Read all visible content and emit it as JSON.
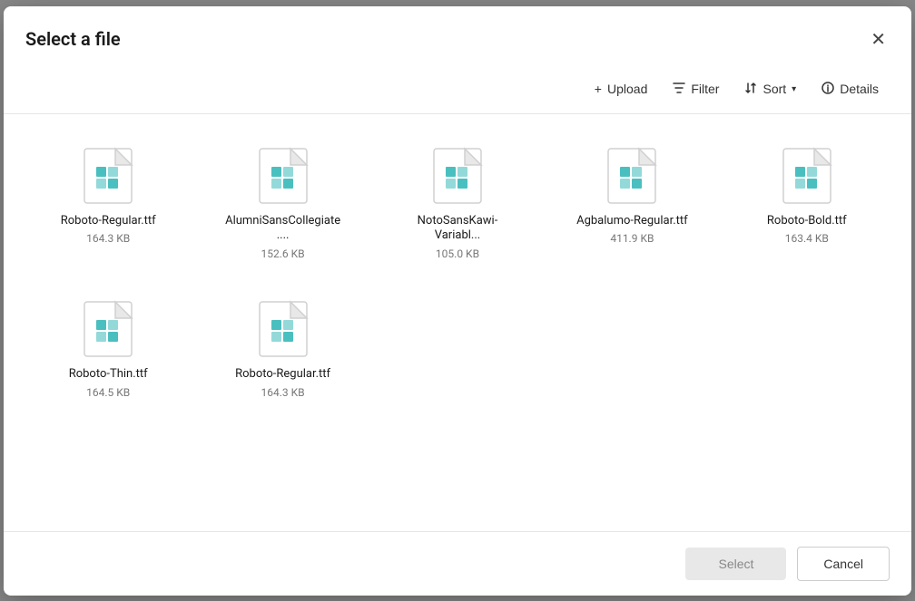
{
  "dialog": {
    "title": "Select a file",
    "close_label": "×"
  },
  "toolbar": {
    "upload_label": "Upload",
    "filter_label": "Filter",
    "sort_label": "Sort",
    "details_label": "Details",
    "upload_icon": "+",
    "filter_icon": "⊿",
    "sort_icon": "↕",
    "details_icon": "ⓘ"
  },
  "files": [
    {
      "name": "Roboto-Regular.ttf",
      "size": "164.3 KB"
    },
    {
      "name": "AlumniSansCollegiate....",
      "size": "152.6 KB"
    },
    {
      "name": "NotoSansKawi-Variabl...",
      "size": "105.0 KB"
    },
    {
      "name": "Agbalumo-Regular.ttf",
      "size": "411.9 KB"
    },
    {
      "name": "Roboto-Bold.ttf",
      "size": "163.4 KB"
    },
    {
      "name": "Roboto-Thin.ttf",
      "size": "164.5 KB"
    },
    {
      "name": "Roboto-Regular.ttf",
      "size": "164.3 KB"
    }
  ],
  "footer": {
    "select_label": "Select",
    "cancel_label": "Cancel"
  }
}
